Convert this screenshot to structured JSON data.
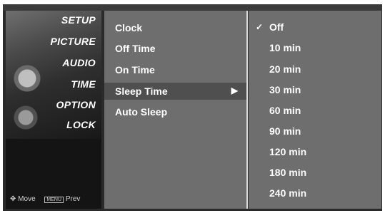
{
  "categories": [
    "SETUP",
    "PICTURE",
    "AUDIO",
    "TIME",
    "OPTION",
    "LOCK"
  ],
  "footer": {
    "move_icon": "move-icon",
    "move_label": "Move",
    "menu_badge": "MENU",
    "prev_label": "Prev"
  },
  "menu": {
    "items": [
      {
        "label": "Clock"
      },
      {
        "label": "Off Time"
      },
      {
        "label": "On Time"
      },
      {
        "label": "Sleep Time",
        "arrow": "▶",
        "selected": true
      },
      {
        "label": "Auto Sleep"
      }
    ]
  },
  "options": {
    "check": "✓",
    "items": [
      "Off",
      "10 min",
      "20 min",
      "30 min",
      "60 min",
      "90 min",
      "120 min",
      "180 min",
      "240 min"
    ],
    "selected": "Off"
  }
}
